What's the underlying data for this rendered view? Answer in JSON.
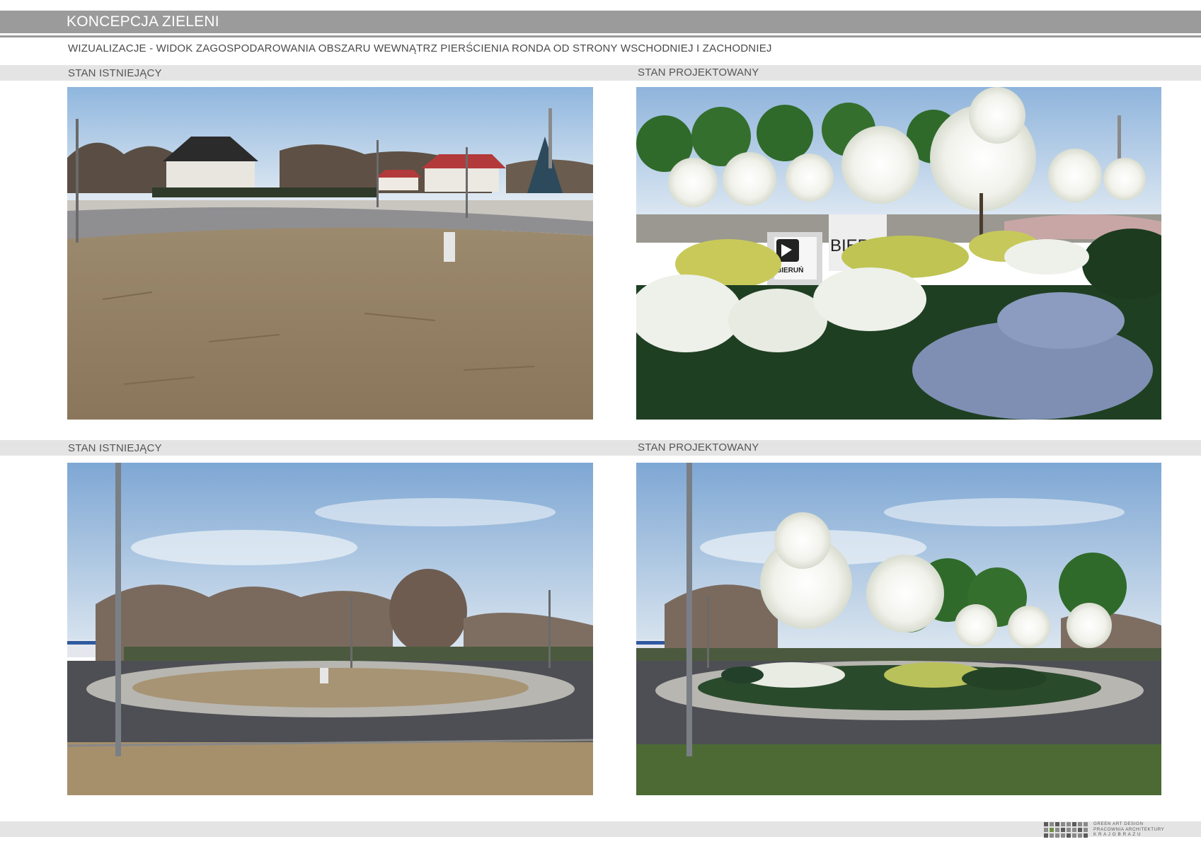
{
  "header": {
    "title": "KONCEPCJA ZIELENI",
    "subtitle": "WIZUALIZACJE - WIDOK ZAGOSPODAROWANIA OBSZARU WEWNĄTRZ PIERŚCIENIA RONDA OD STRONY WSCHODNIEJ I ZACHODNIEJ"
  },
  "sections": {
    "top_left_label": "STAN ISTNIEJĄCY",
    "top_right_label": "STAN PROJEKTOWANY",
    "bottom_left_label": "STAN ISTNIEJĄCY",
    "bottom_right_label": "STAN PROJEKTOWANY"
  },
  "sign": {
    "main_text": "BIERUŃ",
    "logo_text": "BIERUŃ"
  },
  "footer": {
    "logo_line1": "GREEN   ART   DESIGN",
    "logo_line2": "PRACOWNIA ARCHITEKTURY",
    "logo_line3": "K R A J O B R A Z U"
  },
  "colors": {
    "header_bar": "#9b9b9b",
    "band": "#e4e4e4",
    "label_text": "#555555"
  }
}
